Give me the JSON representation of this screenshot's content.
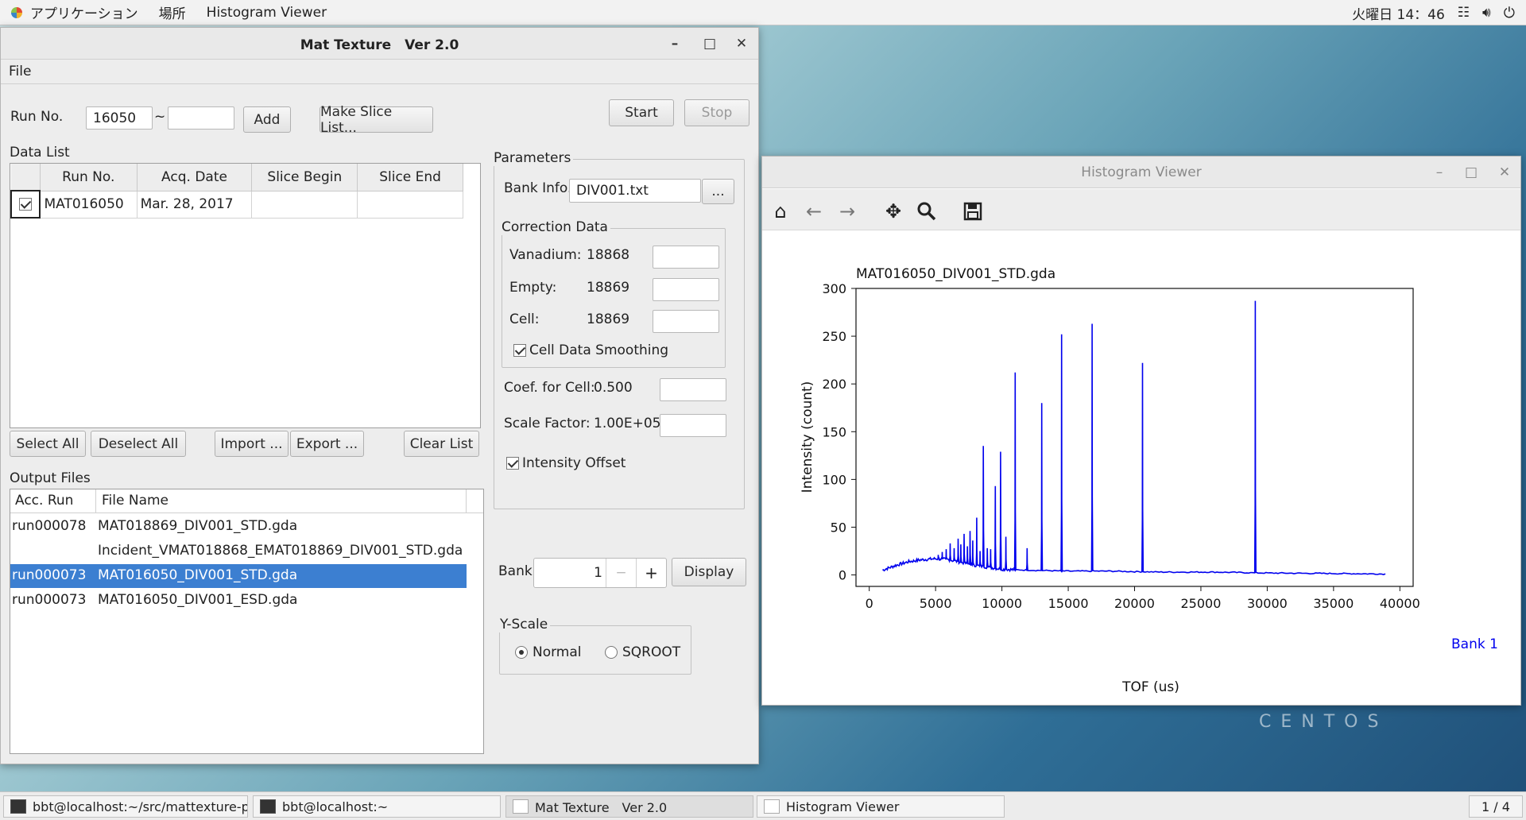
{
  "topbar": {
    "apps": "アプリケーション",
    "places": "場所",
    "active_app": "Histogram Viewer",
    "clock": "火曜日 14：46"
  },
  "mat": {
    "title": "Mat Texture　Ver 2.0",
    "menu_file": "File",
    "run_label": "Run No.",
    "run_from": "16050",
    "run_to": "",
    "tilde": "~",
    "add": "Add",
    "make_slice": "Make Slice List...",
    "start": "Start",
    "stop": "Stop",
    "data_list_label": "Data List",
    "data_columns": [
      "Run No.",
      "Acq. Date",
      "Slice Begin",
      "Slice End"
    ],
    "data_rows": [
      {
        "run": "MAT016050",
        "date": "Mar. 28, 2017",
        "begin": "",
        "end": ""
      }
    ],
    "select_all": "Select All",
    "deselect_all": "Deselect All",
    "import": "Import ...",
    "export": "Export ...",
    "clear_list": "Clear List",
    "output_label": "Output Files",
    "output_columns": [
      "Acc. Run",
      "File Name"
    ],
    "output_rows": [
      {
        "run": "run000078",
        "file": "MAT018869_DIV001_STD.gda"
      },
      {
        "run": "",
        "file": "Incident_VMAT018868_EMAT018869_DIV001_STD.gda"
      },
      {
        "run": "run000073",
        "file": "MAT016050_DIV001_STD.gda"
      },
      {
        "run": "run000073",
        "file": "MAT016050_DIV001_ESD.gda"
      }
    ],
    "params_label": "Parameters",
    "bank_info_label": "Bank Info.",
    "bank_info_value": "DIV001.txt",
    "browse": "...",
    "correction_label": "Correction Data",
    "vanadium_label": "Vanadium:",
    "vanadium_value": "18868",
    "empty_label": "Empty:",
    "empty_value": "18869",
    "cell_label": "Cell:",
    "cell_value": "18869",
    "cell_smoothing": "Cell Data Smoothing",
    "coef_label": "Coef. for Cell:",
    "coef_value": "0.500",
    "scale_label": "Scale Factor:",
    "scale_value": "1.00E+05",
    "intensity_offset": "Intensity Offset",
    "bank_label": "Bank",
    "bank_value": "1",
    "minus": "−",
    "plus": "+",
    "display": "Display",
    "yscale_label": "Y-Scale",
    "normal": "Normal",
    "sqroot": "SQROOT"
  },
  "hist": {
    "title": "Histogram Viewer"
  },
  "chart_data": {
    "type": "line",
    "title": "MAT016050_DIV001_STD.gda",
    "xlabel": "TOF (us)",
    "ylabel": "Intensity (count)",
    "xlim": [
      -1000,
      41000
    ],
    "ylim": [
      -12,
      300
    ],
    "xticks": [
      0,
      5000,
      10000,
      15000,
      20000,
      25000,
      30000,
      35000,
      40000
    ],
    "yticks": [
      0,
      50,
      100,
      150,
      200,
      250,
      300
    ],
    "legend": "Bank 1",
    "legend_position": "right",
    "color": "#0000ee",
    "baseline": [
      [
        1000,
        5
      ],
      [
        2000,
        10
      ],
      [
        3000,
        14
      ],
      [
        4000,
        16
      ],
      [
        5000,
        17
      ],
      [
        6000,
        16
      ],
      [
        7000,
        13
      ],
      [
        8000,
        10
      ],
      [
        9000,
        8
      ],
      [
        10000,
        6
      ],
      [
        12000,
        5
      ],
      [
        15000,
        4
      ],
      [
        18000,
        4
      ],
      [
        22000,
        3
      ],
      [
        26000,
        3
      ],
      [
        30000,
        2
      ],
      [
        35000,
        1.5
      ],
      [
        39000,
        1
      ]
    ],
    "peaks": [
      [
        5200,
        21
      ],
      [
        5500,
        24
      ],
      [
        5800,
        27
      ],
      [
        6100,
        33
      ],
      [
        6400,
        28
      ],
      [
        6700,
        38
      ],
      [
        6900,
        32
      ],
      [
        7150,
        43
      ],
      [
        7400,
        30
      ],
      [
        7600,
        46
      ],
      [
        7800,
        36
      ],
      [
        8100,
        60
      ],
      [
        8350,
        25
      ],
      [
        8600,
        135
      ],
      [
        8900,
        28
      ],
      [
        9150,
        27
      ],
      [
        9500,
        93
      ],
      [
        9900,
        129
      ],
      [
        10300,
        40
      ],
      [
        11000,
        212
      ],
      [
        11900,
        28
      ],
      [
        13000,
        180
      ],
      [
        14500,
        252
      ],
      [
        16800,
        263
      ],
      [
        20600,
        222
      ],
      [
        29100,
        287
      ]
    ]
  }
}
